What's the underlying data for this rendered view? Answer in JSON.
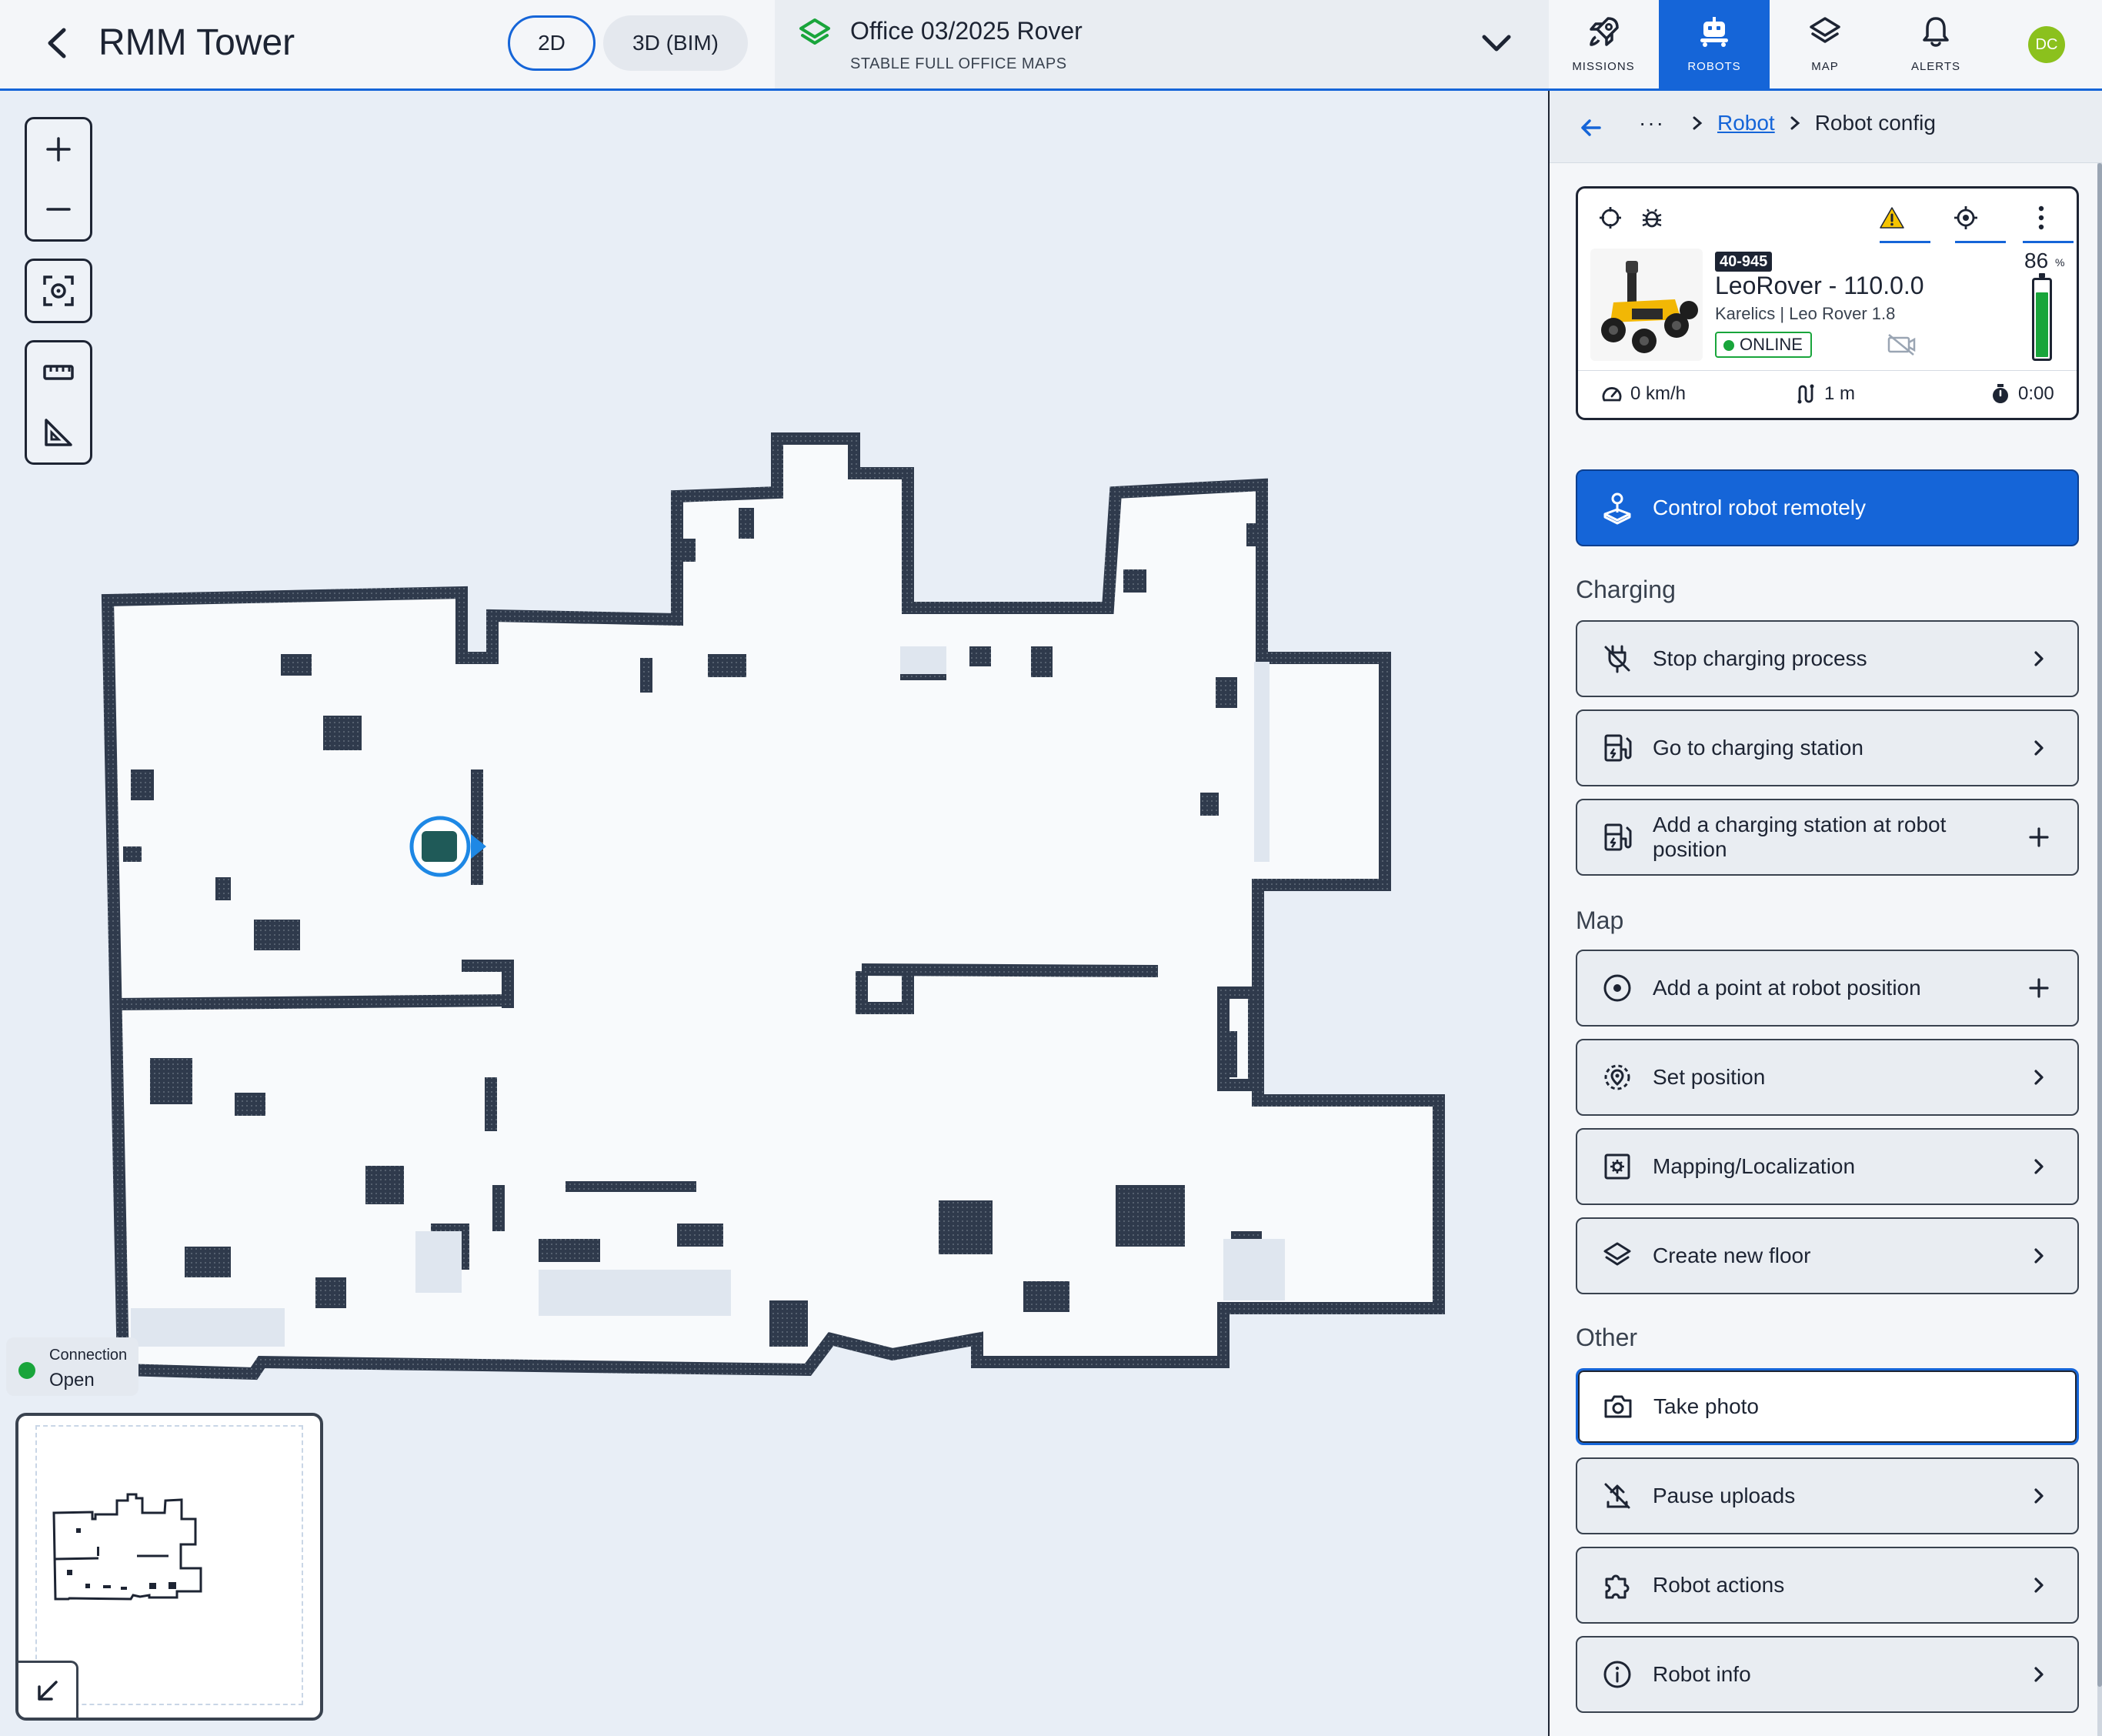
{
  "header": {
    "title": "RMM Tower",
    "view_2d": "2D",
    "view_3d": "3D (BIM)",
    "map_name": "Office 03/2025 Rover",
    "map_subtitle": "STABLE FULL OFFICE MAPS",
    "nav": [
      {
        "label": "MISSIONS",
        "icon": "rocket-icon"
      },
      {
        "label": "ROBOTS",
        "icon": "robot-icon",
        "active": true
      },
      {
        "label": "MAP",
        "icon": "layers-icon"
      },
      {
        "label": "ALERTS",
        "icon": "bell-icon"
      }
    ],
    "avatar_initials": "DC"
  },
  "map": {
    "connection_label": "Connection",
    "connection_status": "Open",
    "connection_color": "#19a53b"
  },
  "panel": {
    "breadcrumb": {
      "ellipsis": "···",
      "parent": "Robot",
      "current": "Robot config"
    },
    "robot": {
      "id_badge": "40-945",
      "name": "LeoRover - 110.0.0",
      "model": "Karelics | Leo Rover 1.8",
      "status": "ONLINE",
      "battery_value": "86",
      "battery_unit": "%",
      "battery_fraction": 0.86,
      "speed": "0 km/h",
      "distance": "1 m",
      "time": "0:00"
    },
    "primary_action": "Control robot remotely",
    "sections": {
      "charging": "Charging",
      "map": "Map",
      "other": "Other"
    },
    "actions": {
      "stop_charging": "Stop charging process",
      "go_charging": "Go to charging station",
      "add_charging": "Add a charging station at robot position",
      "add_point": "Add a point at robot position",
      "set_position": "Set position",
      "mapping": "Mapping/Localization",
      "new_floor": "Create new floor",
      "take_photo": "Take photo",
      "pause_uploads": "Pause uploads",
      "robot_actions": "Robot actions",
      "robot_info": "Robot info"
    }
  },
  "colors": {
    "accent": "#1565d8",
    "online": "#19a53b",
    "warning": "#f5c400",
    "wall": "#2f3a4c"
  }
}
